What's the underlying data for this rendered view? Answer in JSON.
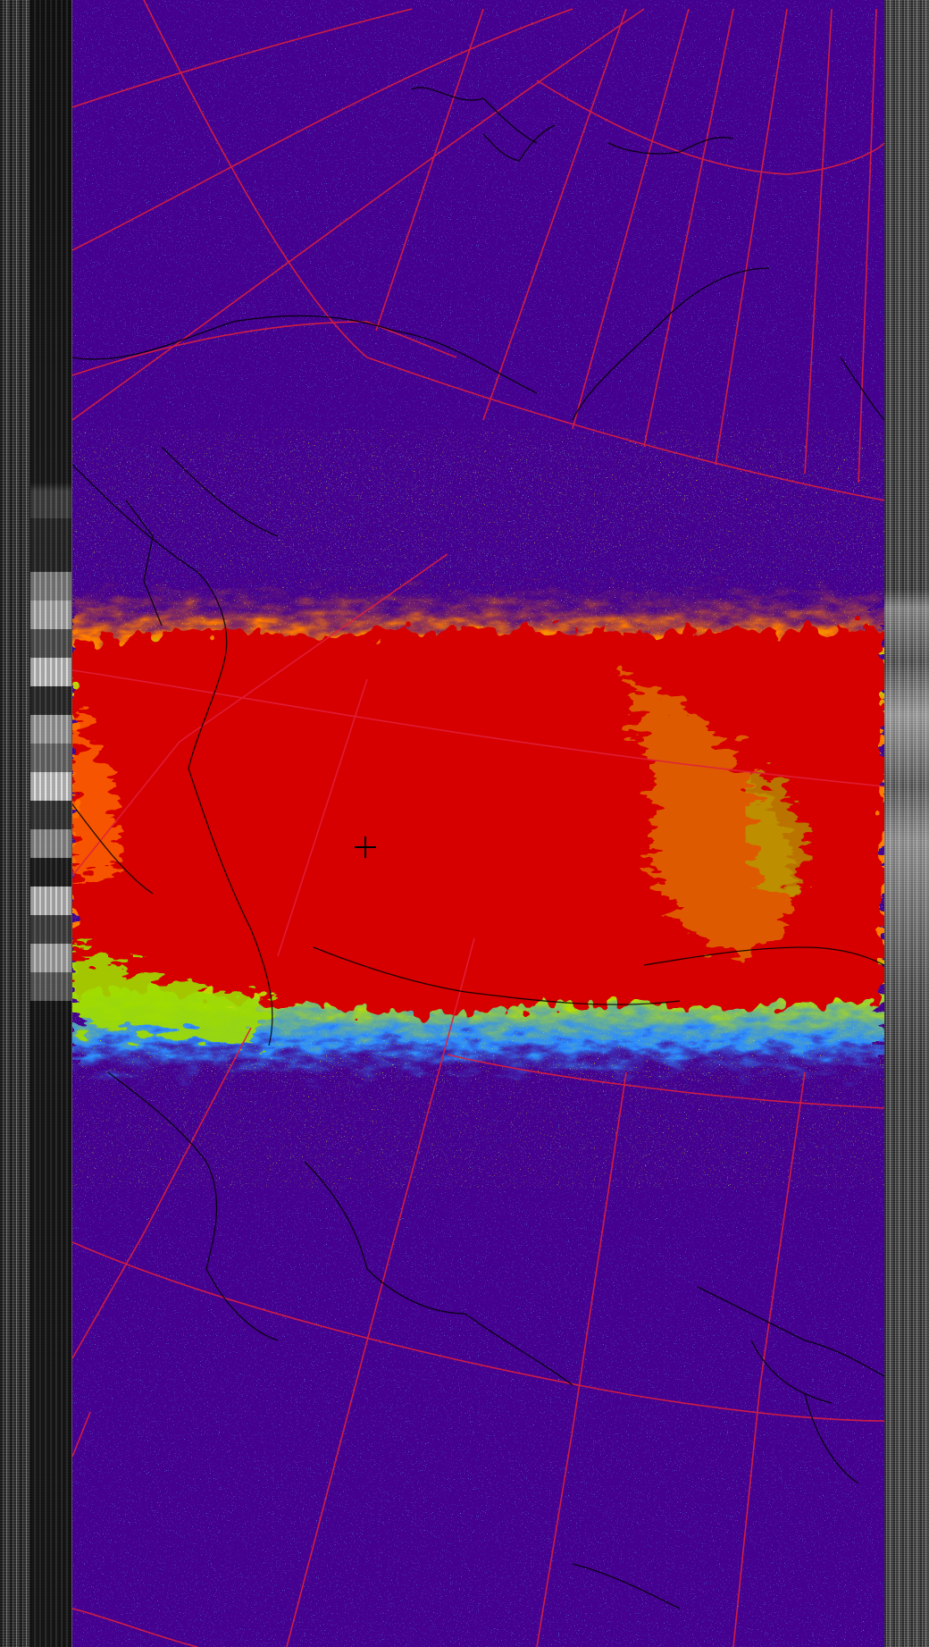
{
  "image": {
    "kind": "satellite-thermal-image",
    "colors": {
      "background": "#45008f",
      "heat_core": "#d60000",
      "heat_mid": "#ff6a00",
      "heat_low": "#b8e000",
      "cool_speckle": "#1aa0ff",
      "graticule": "#e0203c",
      "coastline": "#000000"
    },
    "cursor_icon": "crosshair-icon"
  }
}
